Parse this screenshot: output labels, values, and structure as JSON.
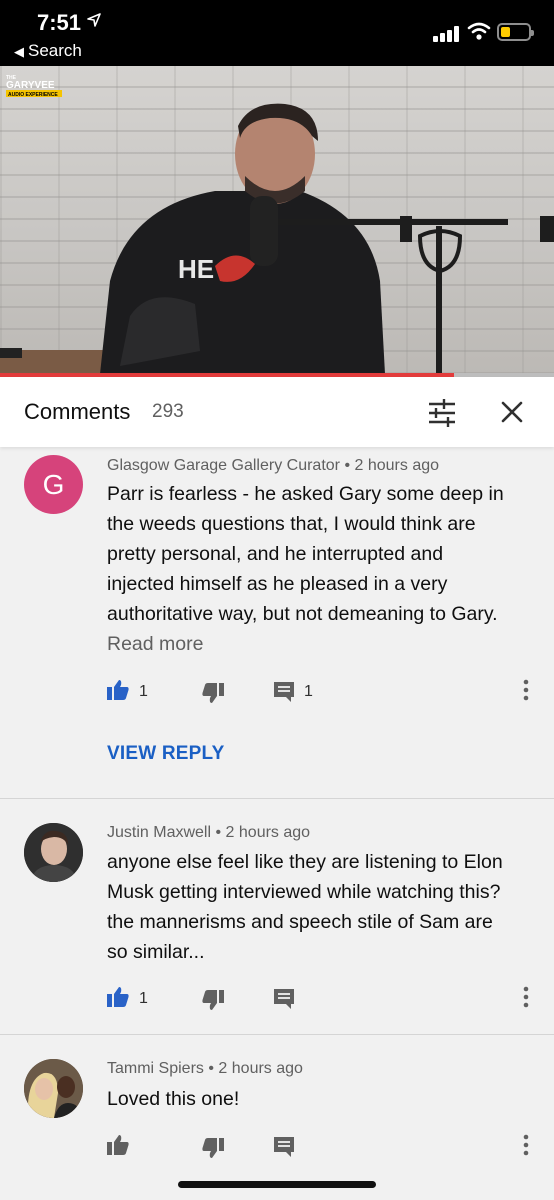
{
  "status_bar": {
    "time": "7:51",
    "back_label": "Search"
  },
  "video": {
    "channel_logo_text": "THE GARYVEE AUDIO EXPERIENCE",
    "progress": 0.82
  },
  "comments_panel": {
    "title": "Comments",
    "count": "293"
  },
  "comments": [
    {
      "author": "Glasgow Garage Gallery Curator",
      "separator": "•",
      "time": "2 hours ago",
      "avatar_letter": "G",
      "avatar_color": "#d6437b",
      "lines": [
        "Parr is fearless - he asked Gary some deep in",
        "the weeds questions that, I would think are",
        "pretty personal, and he interrupted and",
        "injected himself as he pleased in a very",
        "authoritative way, but not demeaning to Gary."
      ],
      "read_more": "Read more",
      "likes": "1",
      "replies": "1",
      "view_reply": "VIEW REPLY"
    },
    {
      "author": "Justin Maxwell",
      "separator": "•",
      "time": "2 hours ago",
      "lines": [
        "anyone else feel like they are listening to Elon",
        "Musk getting interviewed while watching this?",
        "the mannerisms and speech stile of Sam are",
        "so similar..."
      ],
      "likes": "1"
    },
    {
      "author": "Tammi Spiers",
      "separator": "•",
      "time": "2 hours ago",
      "lines": [
        "Loved this one!"
      ]
    }
  ],
  "colors": {
    "like_active": "#2962c7",
    "link_blue": "#1a5fc4",
    "progress_red": "#e23b3b"
  }
}
